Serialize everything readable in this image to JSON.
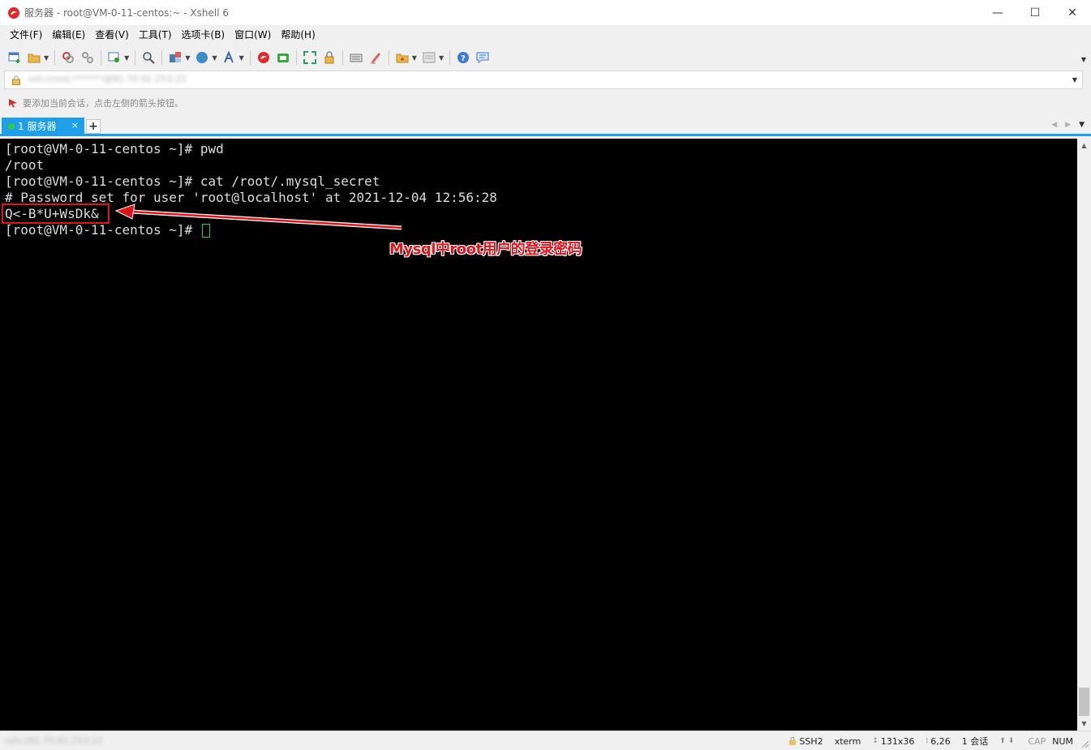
{
  "window": {
    "title": "服务器 - root@VM-0-11-centos:~ - Xshell 6",
    "minimize": "—",
    "maximize": "☐",
    "close": "✕"
  },
  "menu": [
    {
      "label": "文件(F)"
    },
    {
      "label": "编辑(E)"
    },
    {
      "label": "查看(V)"
    },
    {
      "label": "工具(T)"
    },
    {
      "label": "选项卡(B)"
    },
    {
      "label": "窗口(W)"
    },
    {
      "label": "帮助(H)"
    }
  ],
  "address": {
    "value": "ssh://root:*******@81.70.91.253:22"
  },
  "hint": {
    "text": "要添加当前会话，点击左侧的箭头按钮。"
  },
  "tabs": [
    {
      "label": "1 服务器",
      "close": "×"
    }
  ],
  "tab_add": "+",
  "terminal": {
    "lines": [
      "[root@VM-0-11-centos ~]# pwd",
      "/root",
      "[root@VM-0-11-centos ~]# cat /root/.mysql_secret",
      "# Password set for user 'root@localhost' at 2021-12-04 12:56:28",
      "Q<-B*U+WsDk&",
      "[root@VM-0-11-centos ~]# "
    ]
  },
  "annotation": {
    "text": "Mysql中root用户的登录密码",
    "color": "#e0141a"
  },
  "status": {
    "left": "ssh://81.70.91.253:22",
    "protocol": "SSH2",
    "term": "xterm",
    "size": "131x36",
    "cursor_pos": "6,26",
    "sessions": "1 会话",
    "cap": "CAP",
    "num": "NUM"
  },
  "colors": {
    "tab_accent": "#1e9fe8",
    "terminal_bg": "#000000",
    "terminal_fg": "#dcdcdc",
    "cursor": "#2ecc40"
  }
}
